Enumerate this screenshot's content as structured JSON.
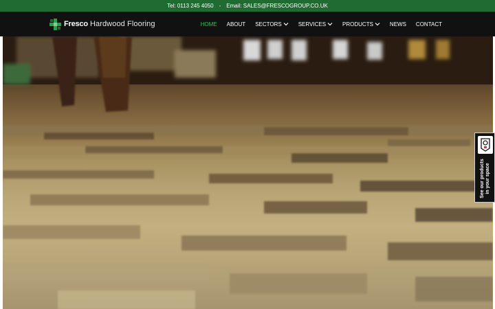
{
  "topbar": {
    "phone": "Tel: 0113 245 4050",
    "separator": "-",
    "email": "Email: SALES@FRESCOGROUP.CO.UK"
  },
  "logo": {
    "brand": "Fresco",
    "rest": "Hardwood Flooring",
    "icon": "green-cross-logo-icon"
  },
  "nav": {
    "items": [
      {
        "label": "HOME",
        "active": true
      },
      {
        "label": "ABOUT"
      },
      {
        "label": "SECTORS",
        "dropdown": true
      },
      {
        "label": "SERVICES",
        "dropdown": true
      },
      {
        "label": "PRODUCTS",
        "dropdown": true
      },
      {
        "label": "NEWS"
      },
      {
        "label": "CONTACT"
      }
    ]
  },
  "side_tab": {
    "label": "See our products in your space",
    "icon": "visualizer-icon"
  },
  "colors": {
    "topbar_bg": "#1f6b32",
    "navbar_bg": "#111111",
    "active_link": "#3dbb5a"
  }
}
